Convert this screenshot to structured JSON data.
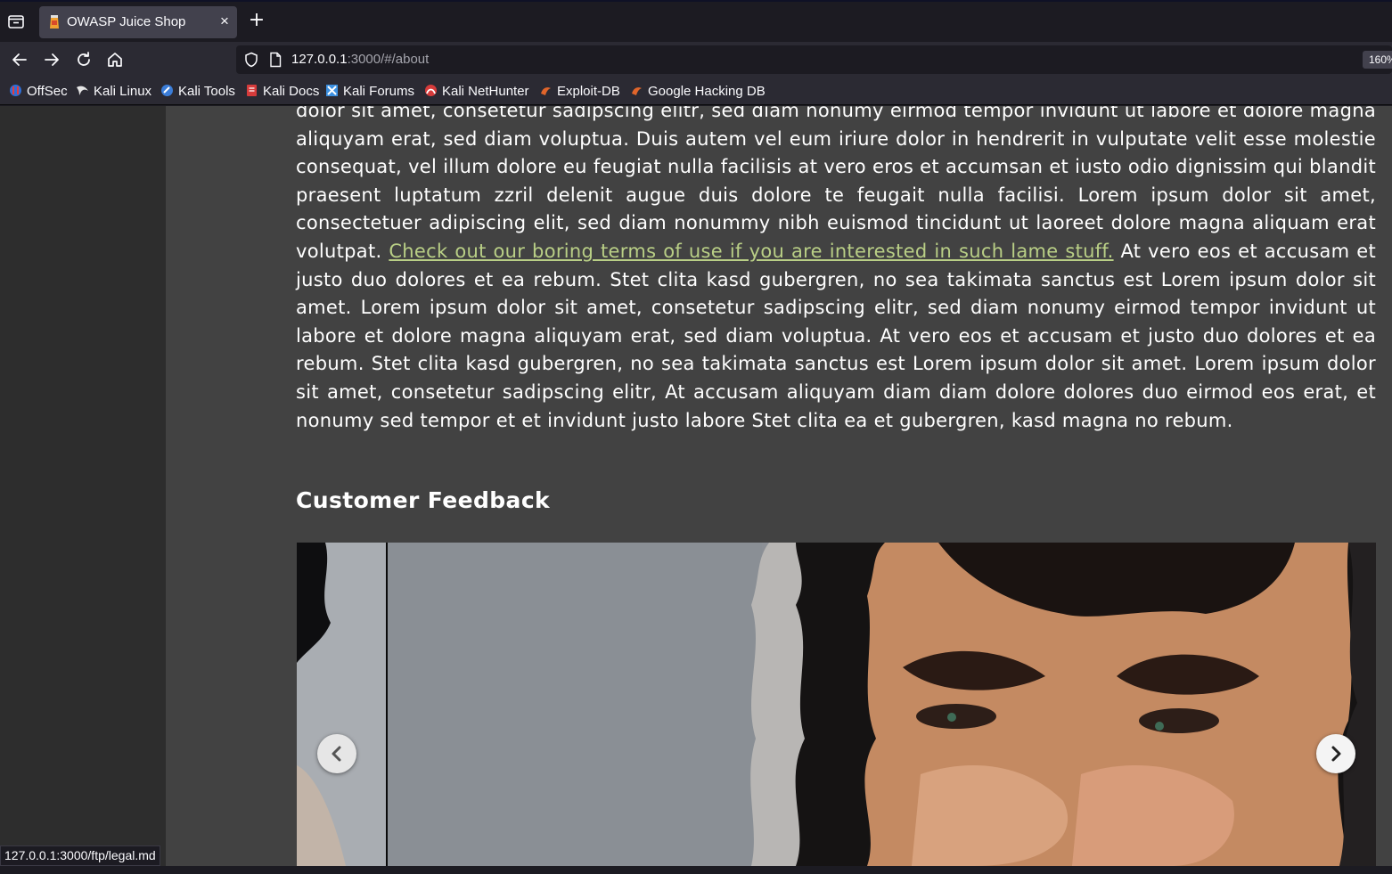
{
  "browser": {
    "tab": {
      "title": "OWASP Juice Shop",
      "close_label": "×"
    },
    "new_tab_label": "+",
    "url": {
      "host": "127.0.0.1",
      "rest": ":3000/#/about"
    },
    "zoom": "160%",
    "bookmarks": [
      {
        "label": "OffSec",
        "icon": "offsec-icon",
        "color": "#2f6fd6"
      },
      {
        "label": "Kali Linux",
        "icon": "kali-dragon-icon",
        "color": "#e6e6e6"
      },
      {
        "label": "Kali Tools",
        "icon": "kali-tools-icon",
        "color": "#3b7dd8"
      },
      {
        "label": "Kali Docs",
        "icon": "kali-docs-icon",
        "color": "#d63b3b"
      },
      {
        "label": "Kali Forums",
        "icon": "kali-forums-icon",
        "color": "#3b8fe0"
      },
      {
        "label": "Kali NetHunter",
        "icon": "nethunter-icon",
        "color": "#d63b3b"
      },
      {
        "label": "Exploit-DB",
        "icon": "exploit-db-icon",
        "color": "#e0652b"
      },
      {
        "label": "Google Hacking DB",
        "icon": "ghdb-icon",
        "color": "#e0652b"
      }
    ],
    "status_url": "127.0.0.1:3000/ftp/legal.md"
  },
  "about": {
    "paragraph_before_link": "dolor sit amet, consetetur sadipscing elitr, sed diam nonumy eirmod tempor invidunt ut labore et dolore magna aliquyam erat, sed diam voluptua. Duis autem vel eum iriure dolor in hendrerit in vulputate velit esse molestie consequat, vel illum dolore eu feugiat nulla facilisis at vero eros et accumsan et iusto odio dignissim qui blandit praesent luptatum zzril delenit augue duis dolore te feugait nulla facilisi. Lorem ipsum dolor sit amet, consectetuer adipiscing elit, sed diam nonummy nibh euismod tincidunt ut laoreet dolore magna aliquam erat volutpat. ",
    "terms_link": "Check out our boring terms of use if you are interested in such lame stuff.",
    "paragraph_after_link": " At vero eos et accusam et justo duo dolores et ea rebum. Stet clita kasd gubergren, no sea takimata sanctus est Lorem ipsum dolor sit amet. Lorem ipsum dolor sit amet, consetetur sadipscing elitr, sed diam nonumy eirmod tempor invidunt ut labore et dolore magna aliquyam erat, sed diam voluptua. At vero eos et accusam et justo duo dolores et ea rebum. Stet clita kasd gubergren, no sea takimata sanctus est Lorem ipsum dolor sit amet. Lorem ipsum dolor sit amet, consetetur sadipscing elitr, At accusam aliquyam diam diam dolore dolores duo eirmod eos erat, et nonumy sed tempor et et invidunt justo labore Stet clita ea et gubergren, kasd magna no rebum.",
    "feedback_heading": "Customer Feedback"
  },
  "colors": {
    "link": "#b9cf86",
    "card": "#424242",
    "sidenav": "#2d2d2d"
  }
}
